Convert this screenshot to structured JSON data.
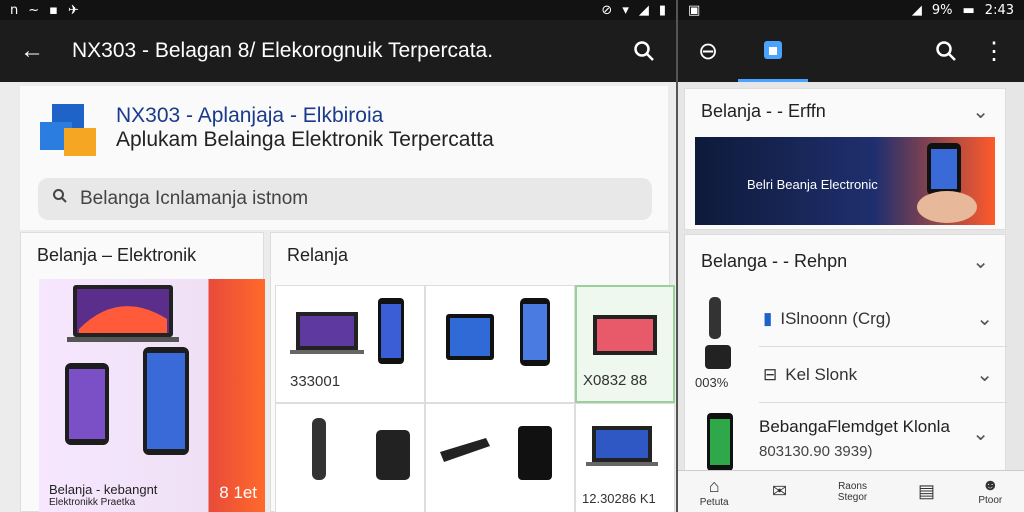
{
  "left": {
    "status": {
      "left_icons": [
        "n",
        "~",
        "▪",
        "✈"
      ],
      "right_icons": [
        "⊘",
        "▾",
        "◢",
        "▮"
      ]
    },
    "appbar": {
      "title": "NX303 - Belagan 8/ Elekorognuik Terpercata."
    },
    "header": {
      "line1": "NX303 - Aplanjaja - Elkbiroia",
      "line2": "Aplukam Belainga Elektronik Terpercatta",
      "search_placeholder": "Belanga Icnlamanja istnom"
    },
    "card_left": {
      "title": "Belanja – Elektronik",
      "promo_text_1": "Belanja - kebangnt",
      "promo_text_2": "Elektronikk Praetka",
      "promo_tag": "8 1et"
    },
    "card_right": {
      "title": "Relanja",
      "cells": [
        "333001",
        "",
        "",
        "X0832 88",
        "",
        "",
        "",
        "12.30286 K1"
      ]
    }
  },
  "right": {
    "status": {
      "time": "2:43",
      "battery_text": "9%"
    },
    "section1": {
      "title": "Belanja - - Erffn",
      "banner_text": "Belri Beanja Electronic"
    },
    "section2": {
      "title": "Belanga - - Rehpn",
      "rows": [
        {
          "icon": "▮",
          "label": "ISlnoonn (Crg)"
        },
        {
          "icon": "⊟",
          "label": "Kel Slonk"
        }
      ],
      "price_left": "003%"
    },
    "promo_item": {
      "title": "BebangaFlemdget Klonla",
      "price": "803130.90 3939)"
    },
    "bottom_nav": [
      {
        "label": "Petuta",
        "icon": "⌂"
      },
      {
        "label": "",
        "icon": "✉"
      },
      {
        "label": "Raons Stegor",
        "icon": ""
      },
      {
        "label": "",
        "icon": "▤"
      },
      {
        "label": "Ptoor",
        "icon": "☻"
      }
    ]
  }
}
